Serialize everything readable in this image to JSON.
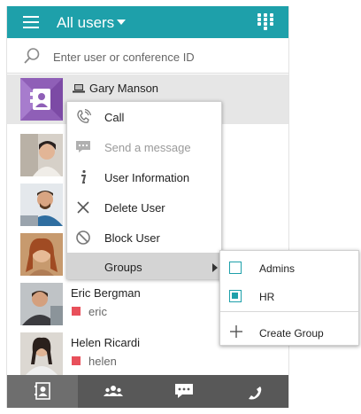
{
  "header": {
    "title": "All users",
    "menu_icon": "hamburger-icon",
    "caret_icon": "caret-down-icon",
    "dialpad_icon": "dialpad-icon"
  },
  "search": {
    "placeholder": "Enter user or conference ID",
    "value": ""
  },
  "contacts": [
    {
      "name": "Gary Manson",
      "id": "",
      "status_color": "",
      "device_icon": "laptop-icon",
      "selected": true
    },
    {
      "name": "",
      "id": "",
      "status_color": ""
    },
    {
      "name": "",
      "id": "",
      "status_color": ""
    },
    {
      "name": "",
      "id": "",
      "status_color": ""
    },
    {
      "name": "Eric Bergman",
      "id": "eric",
      "status_color": "#e8505b"
    },
    {
      "name": "Helen Ricardi",
      "id": "helen",
      "status_color": "#e8505b"
    }
  ],
  "context_menu": {
    "items": [
      {
        "label": "Call",
        "icon": "call-icon",
        "disabled": false
      },
      {
        "label": "Send a message",
        "icon": "message-icon",
        "disabled": true
      },
      {
        "label": "User Information",
        "icon": "info-icon",
        "disabled": false
      },
      {
        "label": "Delete User",
        "icon": "close-icon",
        "disabled": false
      },
      {
        "label": "Block User",
        "icon": "block-icon",
        "disabled": false
      },
      {
        "label": "Groups",
        "icon": "",
        "disabled": false,
        "has_submenu": true,
        "highlighted": true
      }
    ]
  },
  "groups_submenu": {
    "items": [
      {
        "label": "Admins",
        "checked": false
      },
      {
        "label": "HR",
        "checked": true
      }
    ],
    "create_label": "Create Group",
    "create_icon": "plus-icon"
  },
  "bottom_nav": [
    {
      "name": "contacts",
      "icon": "contacts-icon",
      "active": true
    },
    {
      "name": "groups",
      "icon": "people-icon",
      "active": false
    },
    {
      "name": "chat",
      "icon": "chat-icon",
      "active": false
    },
    {
      "name": "calls",
      "icon": "phone-icon",
      "active": false
    }
  ],
  "colors": {
    "accent": "#1ea0aa",
    "bottom_bar": "#585858",
    "status_busy": "#e8505b",
    "highlight": "#d4d4d4"
  }
}
